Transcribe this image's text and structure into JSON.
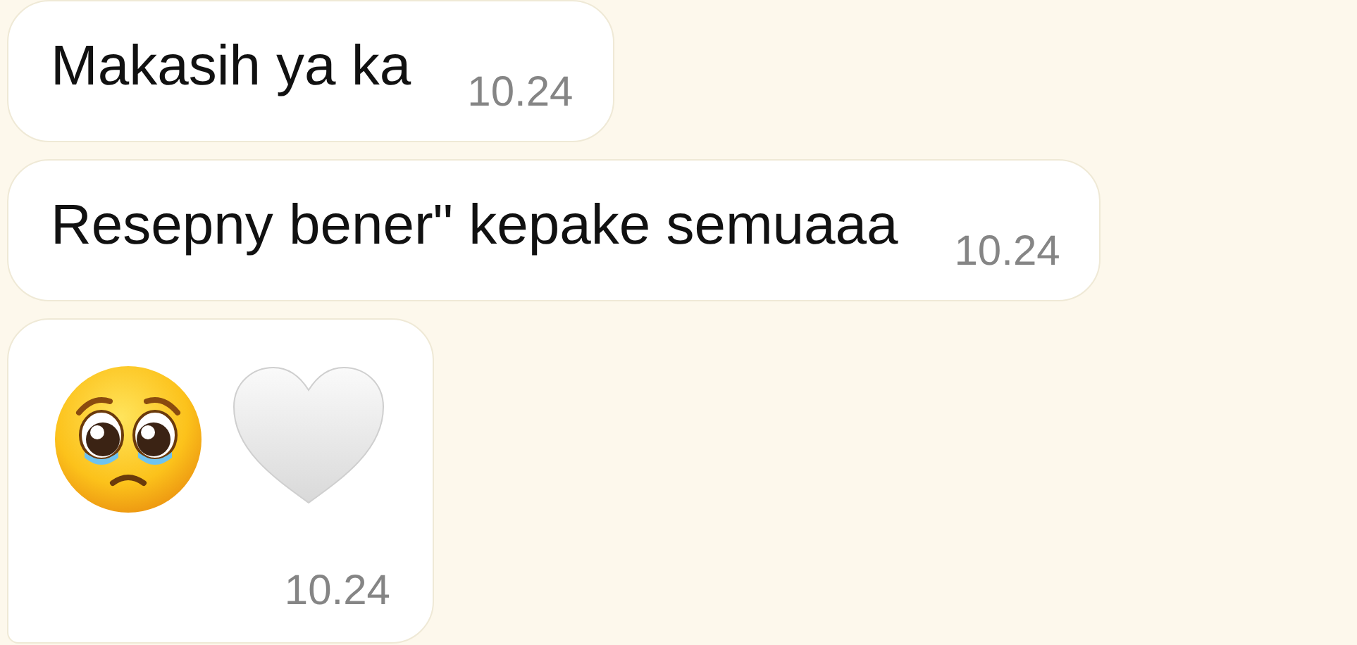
{
  "messages": [
    {
      "kind": "text",
      "text": "Makasih ya ka",
      "time": "10.24"
    },
    {
      "kind": "text",
      "text": "Resepny bener\" kepake semuaaa",
      "time": "10.24"
    },
    {
      "kind": "emoji",
      "time": "10.24"
    }
  ]
}
